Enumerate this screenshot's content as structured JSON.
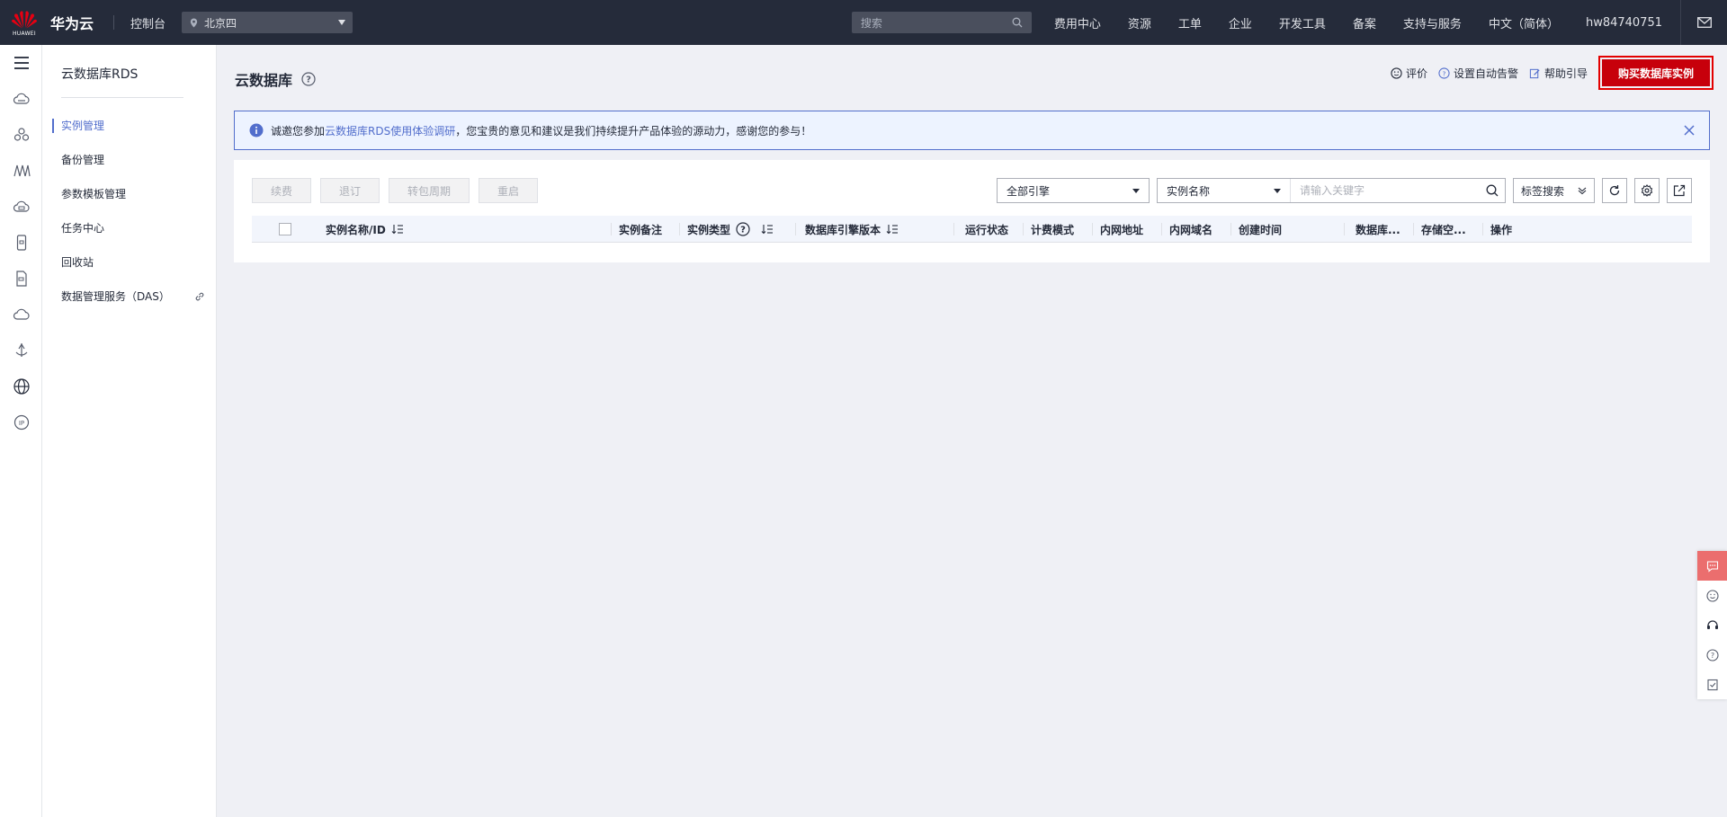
{
  "topbar": {
    "logo_text": "HUAWEI",
    "brand": "华为云",
    "console": "控制台",
    "region": "北京四",
    "search_placeholder": "搜索",
    "nav": [
      "费用中心",
      "资源",
      "工单",
      "企业",
      "开发工具",
      "备案",
      "支持与服务",
      "中文（简体）",
      "hw84740751"
    ]
  },
  "rail": {
    "icons": [
      "menu-icon",
      "cloud-icon",
      "cluster-icon",
      "bridge-icon",
      "cloud-disk-icon",
      "phone-icon",
      "document-icon",
      "cloud-outline-icon",
      "antenna-icon",
      "globe-icon",
      "ip-icon"
    ]
  },
  "sidebar": {
    "title": "云数据库RDS",
    "items": [
      {
        "label": "实例管理",
        "active": true
      },
      {
        "label": "备份管理",
        "active": false
      },
      {
        "label": "参数模板管理",
        "active": false
      },
      {
        "label": "任务中心",
        "active": false
      },
      {
        "label": "回收站",
        "active": false
      },
      {
        "label": "数据管理服务（DAS）",
        "active": false
      }
    ]
  },
  "main": {
    "title": "云数据库",
    "actions": {
      "rate": "评价",
      "alarm": "设置自动告警",
      "guide": "帮助引导",
      "buy": "购买数据库实例"
    },
    "notice": {
      "prefix": "诚邀您参加",
      "link": "云数据库RDS使用体验调研",
      "suffix": "，您宝贵的意见和建议是我们持续提升产品体验的源动力，感谢您的参与！"
    },
    "buttons": [
      "续费",
      "退订",
      "转包周期",
      "重启"
    ],
    "filters": {
      "engine": "全部引擎",
      "field": "实例名称",
      "keyword_placeholder": "请输入关键字",
      "tag_search": "标签搜索"
    },
    "columns": [
      "实例名称/ID",
      "实例备注",
      "实例类型",
      "数据库引擎版本",
      "运行状态",
      "计费模式",
      "内网地址",
      "内网域名",
      "创建时间",
      "数据库...",
      "存储空...",
      "操作"
    ]
  },
  "colors": {
    "topbar_bg": "#252b3a",
    "accent": "#526ecc",
    "buy_button": "#c7000b",
    "float_highlight": "#eb6e6e"
  }
}
